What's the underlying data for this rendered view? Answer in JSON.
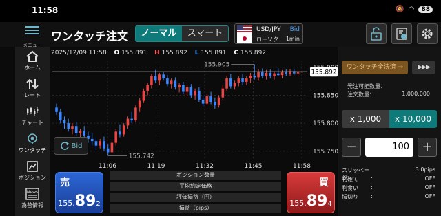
{
  "status": {
    "time": "11:58",
    "battery": "88"
  },
  "header": {
    "menu_label": "メニュー",
    "title": "ワンタッチ注文",
    "mode_tabs": [
      "ノーマル",
      "スマート"
    ],
    "pair": {
      "symbol": "USD/JPY",
      "side": "Bid",
      "chart_kind": "ローソク",
      "timeframe": "1min"
    }
  },
  "sidebar": {
    "items": [
      {
        "label": "ホーム",
        "icon": "home-icon"
      },
      {
        "label": "レート",
        "icon": "rate-arrows-icon"
      },
      {
        "label": "チャート",
        "icon": "chart-icon"
      },
      {
        "label": "ワンタッチ",
        "icon": "onetouch-icon"
      },
      {
        "label": "ポジション",
        "icon": "position-icon"
      },
      {
        "label": "為替情報",
        "icon": "news-icon",
        "badge": "News"
      }
    ]
  },
  "ohlc": {
    "datetime": "2025/12/09 11:58",
    "o_label": "O",
    "o": "155.891",
    "h_label": "H",
    "h": "155.892",
    "l_label": "L",
    "l": "155.891",
    "c_label": "C",
    "c": "155.892"
  },
  "chart_data": {
    "type": "candlestick",
    "x_ticks": [
      "11:06",
      "11:19",
      "11:32",
      "11:45",
      "11:58"
    ],
    "y_ticks": [
      "155.900",
      "155.850",
      "155.800",
      "155.750"
    ],
    "ylim": [
      155.735,
      155.912
    ],
    "current_price": "155.892",
    "max_label": "155.905",
    "min_label": "155.742",
    "bull_color": "#e84545",
    "bear_color": "#3a86ff",
    "candles": [
      [
        155.828,
        155.835,
        155.815,
        155.82
      ],
      [
        155.82,
        155.826,
        155.8,
        155.805
      ],
      [
        155.805,
        155.812,
        155.79,
        155.8
      ],
      [
        155.8,
        155.808,
        155.785,
        155.79
      ],
      [
        155.79,
        155.8,
        155.78,
        155.795
      ],
      [
        155.795,
        155.802,
        155.778,
        155.782
      ],
      [
        155.782,
        155.79,
        155.772,
        155.786
      ],
      [
        155.786,
        155.795,
        155.775,
        155.778
      ],
      [
        155.778,
        155.785,
        155.765,
        155.772
      ],
      [
        155.772,
        155.782,
        155.76,
        155.768
      ],
      [
        155.768,
        155.774,
        155.752,
        155.76
      ],
      [
        155.76,
        155.772,
        155.755,
        155.768
      ],
      [
        155.768,
        155.776,
        155.75,
        155.755
      ],
      [
        155.755,
        155.762,
        155.742,
        155.748
      ],
      [
        155.748,
        155.768,
        155.746,
        155.765
      ],
      [
        155.765,
        155.79,
        155.76,
        155.785
      ],
      [
        155.785,
        155.798,
        155.775,
        155.78
      ],
      [
        155.78,
        155.8,
        155.776,
        155.796
      ],
      [
        155.796,
        155.812,
        155.79,
        155.808
      ],
      [
        155.808,
        155.82,
        155.8,
        155.805
      ],
      [
        155.805,
        155.832,
        155.802,
        155.828
      ],
      [
        155.828,
        155.845,
        155.82,
        155.84
      ],
      [
        155.84,
        155.862,
        155.836,
        155.858
      ],
      [
        155.858,
        155.872,
        155.85,
        155.868
      ],
      [
        155.868,
        155.888,
        155.862,
        155.884
      ],
      [
        155.884,
        155.895,
        155.872,
        155.876
      ],
      [
        155.876,
        155.89,
        155.868,
        155.887
      ],
      [
        155.887,
        155.892,
        155.876,
        155.88
      ],
      [
        155.88,
        155.886,
        155.866,
        155.87
      ],
      [
        155.87,
        155.88,
        155.862,
        155.876
      ],
      [
        155.876,
        155.882,
        155.86,
        155.864
      ],
      [
        155.864,
        155.872,
        155.855,
        155.868
      ],
      [
        155.868,
        155.874,
        155.852,
        155.856
      ],
      [
        155.856,
        155.868,
        155.848,
        155.864
      ],
      [
        155.864,
        155.87,
        155.845,
        155.85
      ],
      [
        155.85,
        155.862,
        155.842,
        155.858
      ],
      [
        155.858,
        155.864,
        155.838,
        155.842
      ],
      [
        155.842,
        155.85,
        155.83,
        155.835
      ],
      [
        155.835,
        155.852,
        155.832,
        155.848
      ],
      [
        155.848,
        155.856,
        155.834,
        155.838
      ],
      [
        155.838,
        155.846,
        155.826,
        155.832
      ],
      [
        155.832,
        155.85,
        155.828,
        155.846
      ],
      [
        155.846,
        155.868,
        155.842,
        155.862
      ],
      [
        155.862,
        155.885,
        155.858,
        155.88
      ],
      [
        155.88,
        155.888,
        155.862,
        155.866
      ],
      [
        155.866,
        155.876,
        155.86,
        155.872
      ],
      [
        155.872,
        155.884,
        155.866,
        155.88
      ],
      [
        155.88,
        155.888,
        155.868,
        155.874
      ],
      [
        155.874,
        155.884,
        155.868,
        155.88
      ],
      [
        155.88,
        155.89,
        155.872,
        155.885
      ],
      [
        155.885,
        155.905,
        155.878,
        155.882
      ],
      [
        155.882,
        155.896,
        155.876,
        155.892
      ],
      [
        155.892,
        155.898,
        155.88,
        155.884
      ],
      [
        155.884,
        155.895,
        155.878,
        155.89
      ],
      [
        155.89,
        155.896,
        155.88,
        155.884
      ],
      [
        155.884,
        155.893,
        155.878,
        155.889
      ],
      [
        155.889,
        155.898,
        155.884,
        155.886
      ],
      [
        155.886,
        155.895,
        155.88,
        155.891
      ],
      [
        155.891,
        155.896,
        155.884,
        155.888
      ],
      [
        155.888,
        155.896,
        155.884,
        155.893
      ],
      [
        155.893,
        155.897,
        155.886,
        155.889
      ],
      [
        155.889,
        155.894,
        155.885,
        155.891
      ],
      [
        155.891,
        155.892,
        155.891,
        155.892
      ]
    ]
  },
  "bid_toggle": "Bid",
  "sell": {
    "label": "売",
    "price_head": "155.",
    "price_big": "89",
    "price_pip": "2"
  },
  "buy": {
    "label": "買",
    "price_head": "155.",
    "price_big": "89",
    "price_pip": "4"
  },
  "summary_rows": [
    "ポジション数量",
    "平均約定価格",
    "評価損益（円）",
    "損益（pips）"
  ],
  "right": {
    "all_close": "ワンタッチ全決済 →",
    "more": "▶▶▶",
    "orderable_label": "発注可能数量：",
    "orderable_value": "",
    "order_qty_label": "注文数量：",
    "order_qty_value": "1,000,000",
    "lot_options": [
      "x 1,000",
      "x 10,000"
    ],
    "minus": "−",
    "plus": "+",
    "quantity": "100",
    "options": [
      {
        "key": "スリッページ",
        "sep": ":",
        "value": "3.0pips"
      },
      {
        "key": "利確て",
        "sep": ":",
        "value": "OFF"
      },
      {
        "key": "利食い",
        "sep": ":",
        "value": "OFF"
      },
      {
        "key": "損切り",
        "sep": ":",
        "value": "OFF"
      }
    ]
  }
}
